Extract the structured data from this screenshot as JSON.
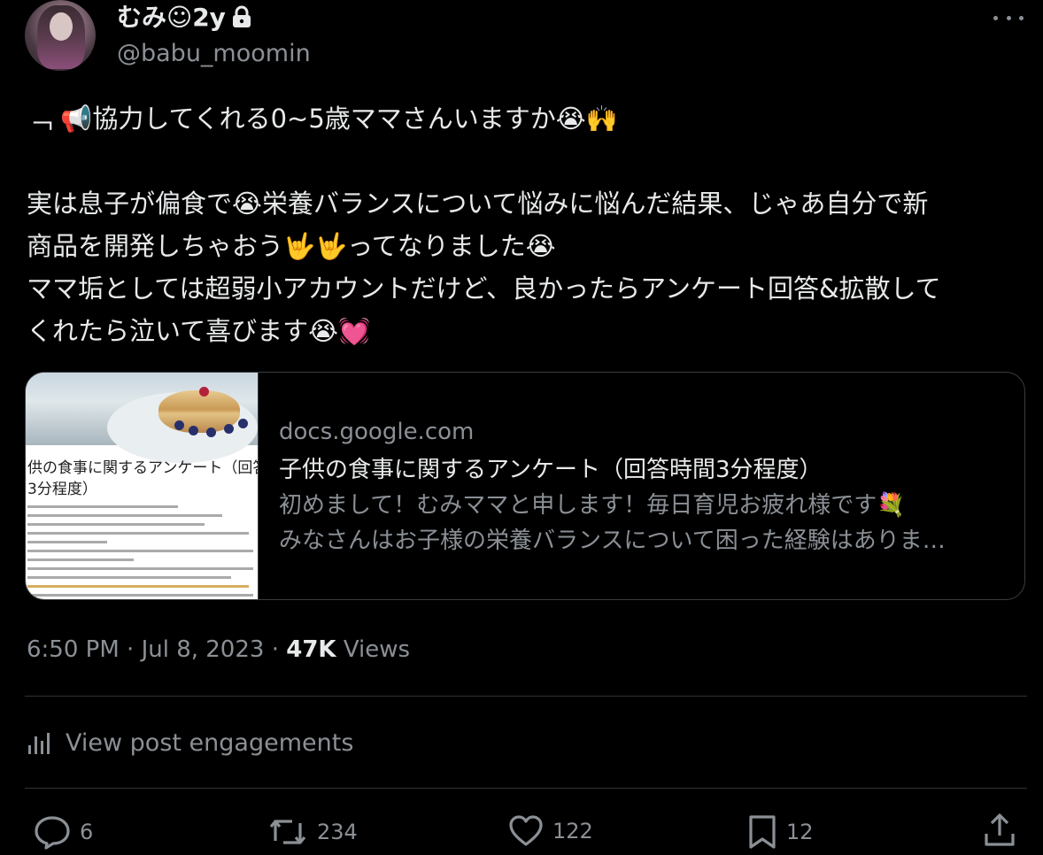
{
  "user": {
    "name": "むみ☺2y",
    "handle": "@babu_moomin"
  },
  "tweet": {
    "lines": [
      "﹁ 📢協力してくれる0~5歳ママさんいますか😭🙌",
      "実は息子が偏食で😭栄養バランスについて悩みに悩んだ結果、じゃあ自分で新",
      "商品を開発しちゃおう🤟🤟ってなりました😭",
      "ママ垢としては超弱小アカウントだけど、良かったらアンケート回答&拡散して",
      "くれたら泣いて喜びます😭💓"
    ]
  },
  "card": {
    "domain": "docs.google.com",
    "title": "子供の食事に関するアンケート（回答時間3分程度）",
    "description_1": "初めまして！むみママと申します！毎日育児お疲れ様です💐",
    "description_2": "みなさんはお子様の栄養バランスについて困った経験はありま…",
    "thumb_title_1": "供の食事に関するアンケート（回答時",
    "thumb_title_2": "3分程度）"
  },
  "meta": {
    "time": "6:50 PM",
    "separator": "·",
    "date": "Jul 8, 2023",
    "views_count": "47K",
    "views_label": "Views"
  },
  "engagements_label": "View post engagements",
  "actions": {
    "replies": "6",
    "reposts": "234",
    "likes": "122",
    "bookmarks": "12"
  },
  "icons": [
    "lock-icon",
    "more-icon",
    "bar-chart-icon",
    "reply-icon",
    "repost-icon",
    "like-icon",
    "bookmark-icon",
    "share-icon"
  ]
}
